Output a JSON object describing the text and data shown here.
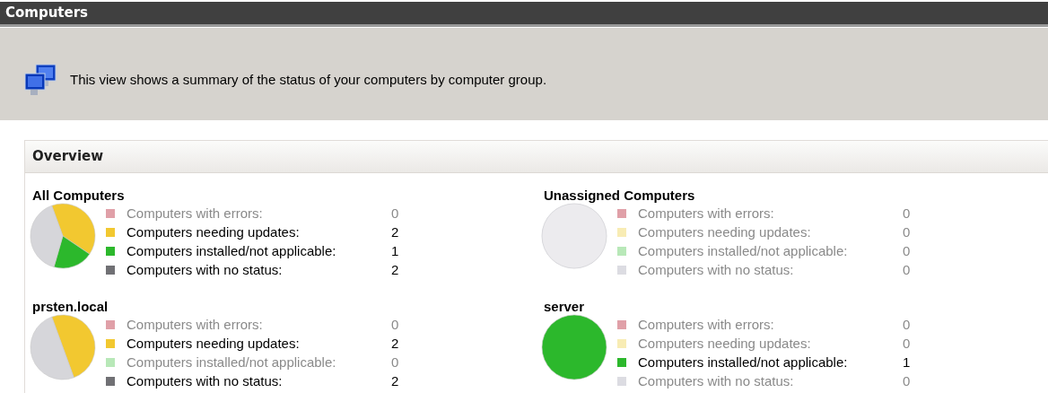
{
  "window": {
    "title": "Computers"
  },
  "info": {
    "text": "This view shows a summary of the status of your computers by computer group."
  },
  "overview": {
    "title": "Overview",
    "groups": [
      {
        "name": "All Computers",
        "legend": [
          {
            "label": "Computers with errors:",
            "count": "0",
            "active": false,
            "color": "#e0a0a8"
          },
          {
            "label": "Computers needing updates:",
            "count": "2",
            "active": true,
            "color": "#f2c830"
          },
          {
            "label": "Computers installed/not applicable:",
            "count": "1",
            "active": true,
            "color": "#2cb82c"
          },
          {
            "label": "Computers with no status:",
            "count": "2",
            "active": true,
            "color": "#707074"
          }
        ]
      },
      {
        "name": "Unassigned Computers",
        "legend": [
          {
            "label": "Computers with errors:",
            "count": "0",
            "active": false,
            "color": "#e0a0a8"
          },
          {
            "label": "Computers needing updates:",
            "count": "0",
            "active": false,
            "color": "#f8ecb4"
          },
          {
            "label": "Computers installed/not applicable:",
            "count": "0",
            "active": false,
            "color": "#b8e8b8"
          },
          {
            "label": "Computers with no status:",
            "count": "0",
            "active": false,
            "color": "#dcdce2"
          }
        ]
      },
      {
        "name": "prsten.local",
        "legend": [
          {
            "label": "Computers with errors:",
            "count": "0",
            "active": false,
            "color": "#e0a0a8"
          },
          {
            "label": "Computers needing updates:",
            "count": "2",
            "active": true,
            "color": "#f2c830"
          },
          {
            "label": "Computers installed/not applicable:",
            "count": "0",
            "active": false,
            "color": "#b8e8b8"
          },
          {
            "label": "Computers with no status:",
            "count": "2",
            "active": true,
            "color": "#707074"
          }
        ]
      },
      {
        "name": "server",
        "legend": [
          {
            "label": "Computers with errors:",
            "count": "0",
            "active": false,
            "color": "#e0a0a8"
          },
          {
            "label": "Computers needing updates:",
            "count": "0",
            "active": false,
            "color": "#f8ecb4"
          },
          {
            "label": "Computers installed/not applicable:",
            "count": "1",
            "active": true,
            "color": "#2cb82c"
          },
          {
            "label": "Computers with no status:",
            "count": "0",
            "active": false,
            "color": "#dcdce2"
          }
        ]
      }
    ]
  }
}
